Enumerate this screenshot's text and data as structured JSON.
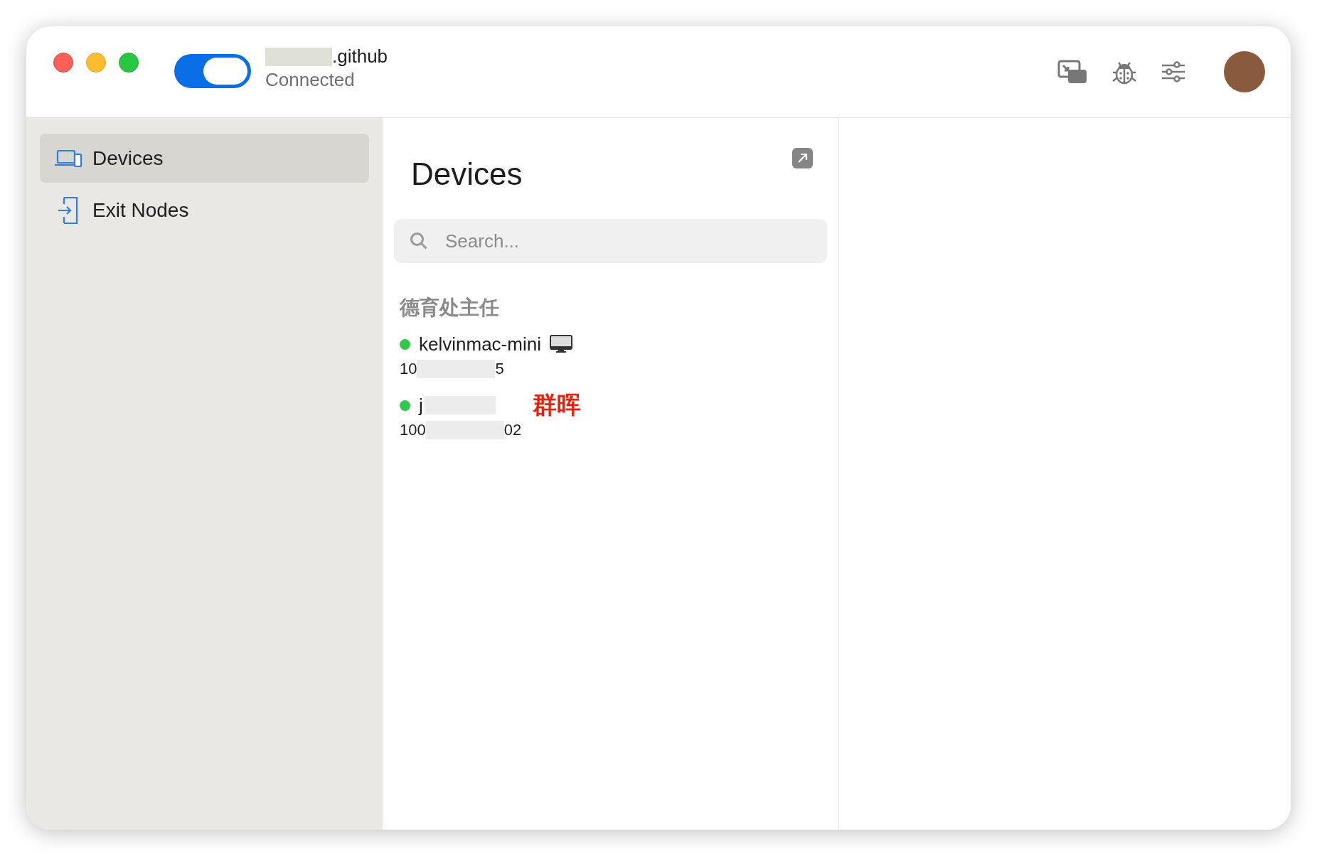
{
  "connection": {
    "on": true,
    "tailnet_suffix": ".github",
    "status": "Connected"
  },
  "sidebar": {
    "items": [
      {
        "label": "Devices",
        "selected": true,
        "kind": "devices"
      },
      {
        "label": "Exit Nodes",
        "selected": false,
        "kind": "exit"
      }
    ]
  },
  "devices_panel": {
    "title": "Devices",
    "search": {
      "placeholder": "Search..."
    },
    "groups": [
      {
        "label": "德育处主任",
        "devices": [
          {
            "name": "kelvinmac-mini",
            "online": true,
            "desktop_icon": true,
            "address_start": "10",
            "address_end": "5"
          },
          {
            "name": "j",
            "online": true,
            "desktop_icon": false,
            "address_start": "100",
            "address_end": "02",
            "annotation": "群晖"
          }
        ]
      }
    ]
  }
}
